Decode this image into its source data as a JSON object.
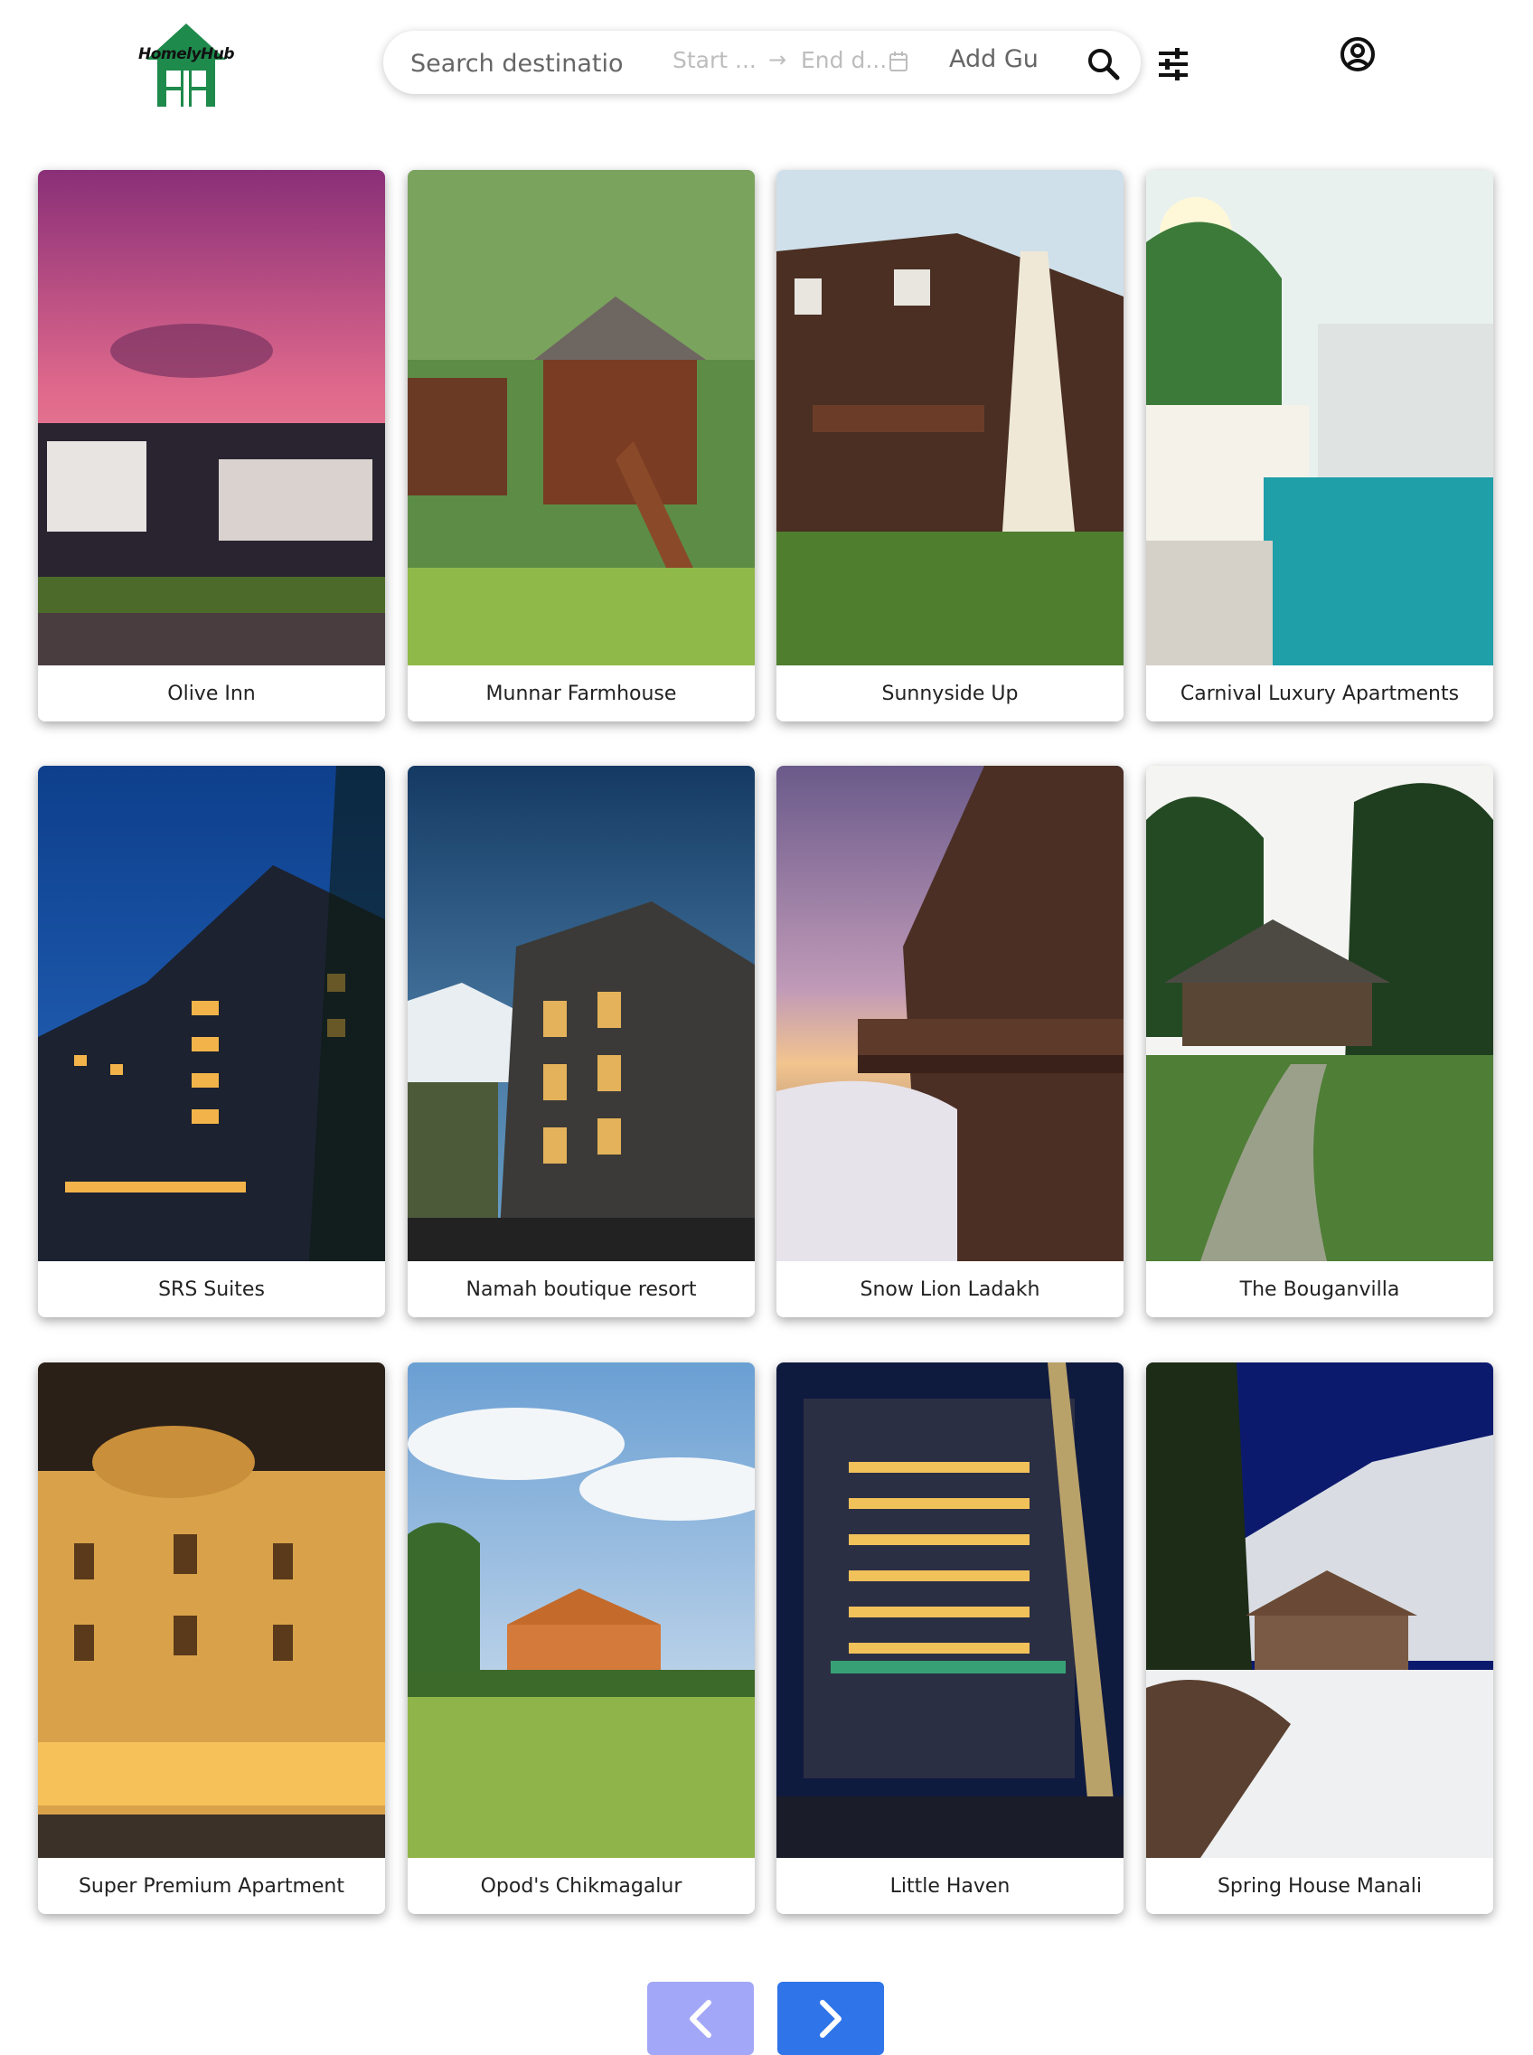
{
  "header": {
    "logo_text": "HomelyHub",
    "search": {
      "placeholder": "Search destinatio",
      "start_placeholder": "Start ...",
      "end_placeholder": "End d...",
      "guests_placeholder": "Add Gu",
      "search_icon": "search-icon",
      "calendar_icon": "calendar-icon"
    },
    "filter_icon": "sliders-icon",
    "profile_icon": "user-circle-icon"
  },
  "properties": [
    {
      "name": "Olive Inn"
    },
    {
      "name": "Munnar Farmhouse"
    },
    {
      "name": "Sunnyside Up"
    },
    {
      "name": "Carnival Luxury Apartments"
    },
    {
      "name": "SRS Suites"
    },
    {
      "name": "Namah boutique resort"
    },
    {
      "name": "Snow Lion Ladakh"
    },
    {
      "name": "The Bouganvilla"
    },
    {
      "name": "Super Premium Apartment"
    },
    {
      "name": "Opod's Chikmagalur"
    },
    {
      "name": "Little Haven"
    },
    {
      "name": "Spring House Manali"
    }
  ],
  "pagination": {
    "prev_icon": "chevron-left-icon",
    "next_icon": "chevron-right-icon",
    "prev_color": "#a3a7f7",
    "next_color": "#2f74e8"
  },
  "colors": {
    "brand_green": "#1e8a4c"
  }
}
